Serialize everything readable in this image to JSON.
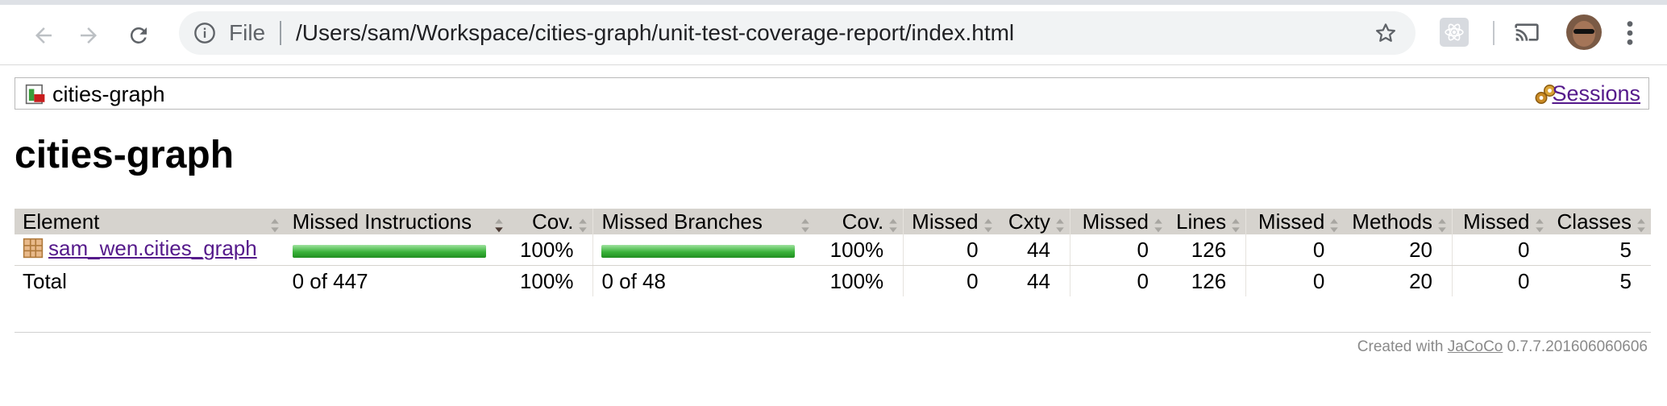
{
  "browser": {
    "address_scheme_label": "File",
    "url": "/Users/sam/Workspace/cities-graph/unit-test-coverage-report/index.html"
  },
  "breadcrumb": {
    "report_name": "cities-graph",
    "sessions_label": "Sessions"
  },
  "page": {
    "title": "cities-graph"
  },
  "table": {
    "headers": {
      "element": "Element",
      "missed_instructions": "Missed Instructions",
      "instr_cov": "Cov.",
      "missed_branches": "Missed Branches",
      "branch_cov": "Cov.",
      "missed_cxty": "Missed",
      "cxty": "Cxty",
      "missed_lines": "Missed",
      "lines": "Lines",
      "missed_methods": "Missed",
      "methods": "Methods",
      "missed_classes": "Missed",
      "classes": "Classes"
    },
    "rows": [
      {
        "element": "sam_wen.cities_graph",
        "instr_coverage_fraction": 1.0,
        "instr_cov": "100%",
        "branch_coverage_fraction": 1.0,
        "branch_cov": "100%",
        "missed_cxty": "0",
        "cxty": "44",
        "missed_lines": "0",
        "lines": "126",
        "missed_methods": "0",
        "methods": "20",
        "missed_classes": "0",
        "classes": "5"
      }
    ],
    "total": {
      "label": "Total",
      "missed_instructions": "0 of 447",
      "instr_cov": "100%",
      "missed_branches": "0 of 48",
      "branch_cov": "100%",
      "missed_cxty": "0",
      "cxty": "44",
      "missed_lines": "0",
      "lines": "126",
      "missed_methods": "0",
      "methods": "20",
      "missed_classes": "0",
      "classes": "5"
    }
  },
  "footer": {
    "prefix": "Created with",
    "link": "JaCoCo",
    "version": "0.7.7.201606060606"
  },
  "colors": {
    "coverage_bar": "#39b339",
    "table_header_bg": "#d6d3ce",
    "link": "#551a8b"
  }
}
